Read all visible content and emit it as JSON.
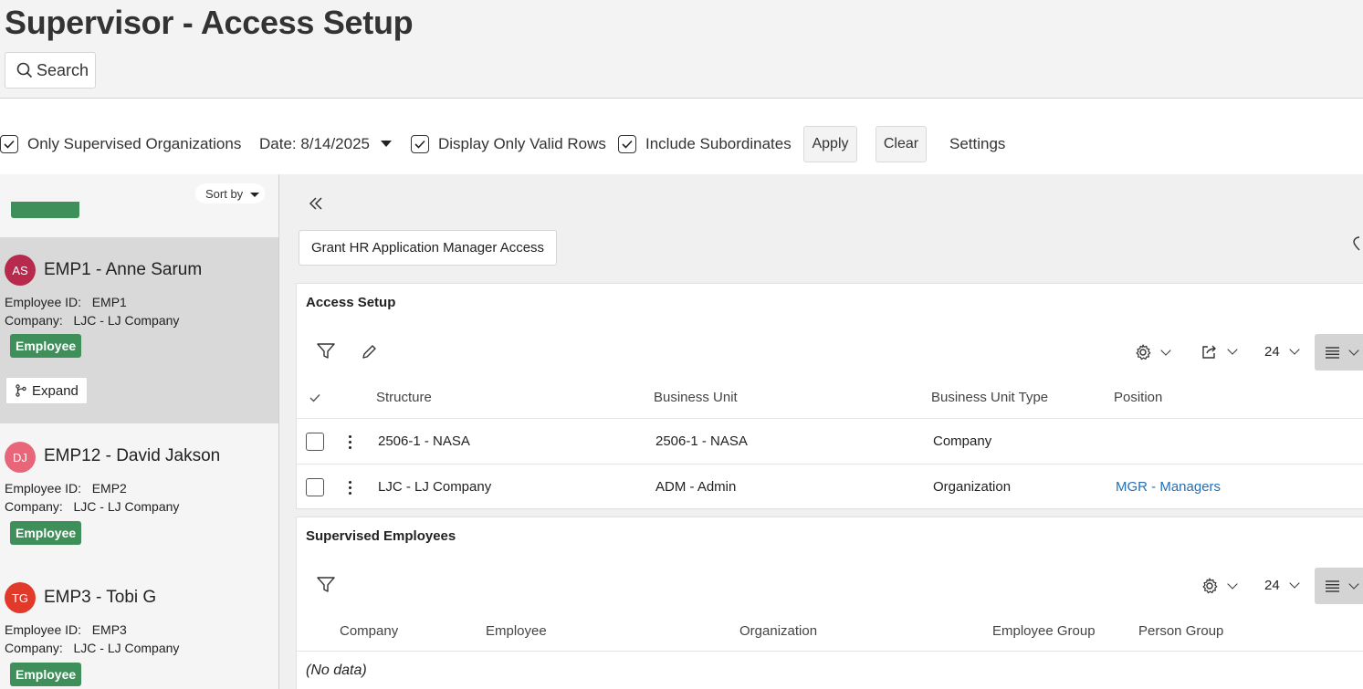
{
  "header": {
    "title": "Supervisor - Access Setup",
    "search_label": "Search"
  },
  "filters": {
    "only_supervised_orgs": "Only Supervised Organizations",
    "date": "Date: 8/14/2025",
    "display_only_valid_rows": "Display Only Valid Rows",
    "include_subordinates": "Include Subordinates",
    "apply": "Apply",
    "clear": "Clear",
    "settings": "Settings"
  },
  "sidebar": {
    "sort_by": "Sort by",
    "expand_label": "Expand",
    "cards": [
      {
        "initials": "AS",
        "name": "EMP1 - Anne Sarum",
        "employee_id_label": "Employee ID:   EMP1",
        "company_label": "Company:   LJC - LJ Company",
        "badge": "Employee",
        "avatar_color": "#b72a4e"
      },
      {
        "initials": "DJ",
        "name": "EMP12 - David Jakson",
        "employee_id_label": "Employee ID:   EMP2",
        "company_label": "Company:   LJC - LJ Company",
        "badge": "Employee",
        "avatar_color": "#e8667a"
      },
      {
        "initials": "TG",
        "name": "EMP3 - Tobi G",
        "employee_id_label": "Employee ID:   EMP3",
        "company_label": "Company:   LJC - LJ Company",
        "badge": "Employee",
        "avatar_color": "#e23a2a"
      }
    ]
  },
  "main": {
    "grant_button": "Grant HR Application Manager Access",
    "access_setup": {
      "title": "Access Setup",
      "page_size": "24",
      "columns": [
        "Structure",
        "Business Unit",
        "Business Unit Type",
        "Position"
      ],
      "rows": [
        {
          "structure": "2506-1 - NASA",
          "business_unit": "2506-1 - NASA",
          "business_unit_type": "Company",
          "position": ""
        },
        {
          "structure": "LJC - LJ Company",
          "business_unit": "ADM - Admin",
          "business_unit_type": "Organization",
          "position": "MGR - Managers"
        }
      ]
    },
    "supervised_employees": {
      "title": "Supervised Employees",
      "page_size": "24",
      "columns": [
        "Company",
        "Employee",
        "Organization",
        "Employee Group",
        "Person Group"
      ],
      "empty_text": "(No data)"
    }
  },
  "colors": {
    "badge_green": "#3f8f5a",
    "link_blue": "#2470b8"
  }
}
